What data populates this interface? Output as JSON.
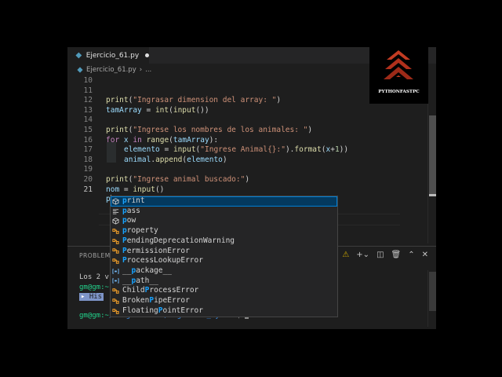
{
  "tab": {
    "filename": "Ejercicio_61.py"
  },
  "breadcrumb": {
    "file": "Ejercicio_61.py",
    "more": "..."
  },
  "editor": {
    "line_numbers": [
      "10",
      "11",
      "12",
      "13",
      "14",
      "15",
      "16",
      "17",
      "18",
      "19",
      "20",
      "21"
    ]
  },
  "code": {
    "l11_print": "print",
    "l11_str": "\"Ingrasar dimension del array: \"",
    "l12_var": "tamArray",
    "l12_int": "int",
    "l12_input": "input",
    "l14_print": "print",
    "l14_str": "\"Ingrese los nombres de los animales: \"",
    "l15_for": "for",
    "l15_x": "x",
    "l15_in": "in",
    "l15_range": "range",
    "l15_arg": "tamArray",
    "l16_var": "elemento",
    "l16_input": "input",
    "l16_str": "\"Ingrese Animal{}:\"",
    "l16_format": "format",
    "l16_x": "x",
    "l16_num": "1",
    "l17_var": "animal",
    "l17_append": "append",
    "l17_arg": "elemento",
    "l19_print": "print",
    "l19_str": "\"Ingrese animal buscado:\"",
    "l20_var": "nom",
    "l20_input": "input",
    "l21_typed": "p"
  },
  "suggestions": [
    {
      "m": "p",
      "rest": "rint",
      "icon": "cube"
    },
    {
      "m": "p",
      "rest": "ass",
      "icon": "keyword"
    },
    {
      "m": "p",
      "rest": "ow",
      "icon": "cube"
    },
    {
      "m": "p",
      "rest": "roperty",
      "icon": "class"
    },
    {
      "m": "P",
      "rest": "endingDeprecationWarning",
      "icon": "class"
    },
    {
      "m": "P",
      "rest": "ermissionError",
      "icon": "class"
    },
    {
      "m": "P",
      "rest": "rocessLookupError",
      "icon": "class"
    },
    {
      "pre": "__",
      "m": "p",
      "rest": "ackage__",
      "icon": "variable"
    },
    {
      "pre": "__",
      "m": "p",
      "rest": "ath__",
      "icon": "variable"
    },
    {
      "pre": "Child",
      "m": "P",
      "rest": "rocessError",
      "icon": "class"
    },
    {
      "pre": "Broken",
      "m": "P",
      "rest": "ipeError",
      "icon": "class"
    },
    {
      "pre": "Floating",
      "m": "P",
      "rest": "ointError",
      "icon": "class"
    }
  ],
  "panel": {
    "tab_label": "PROBLEMA",
    "term_line1": "Los 2 v",
    "history_label": "His",
    "prompt_user": "gm@gm:~",
    "prompt_path": "/Programacion/Algoritmo_Python",
    "prompt_end": "$"
  },
  "logo": {
    "text": "PYTHONFASTPC"
  },
  "colors": {
    "selection": "#04395e",
    "match": "#18a3ff",
    "class_icon": "#ee9d28",
    "prompt": "#23d18b"
  }
}
